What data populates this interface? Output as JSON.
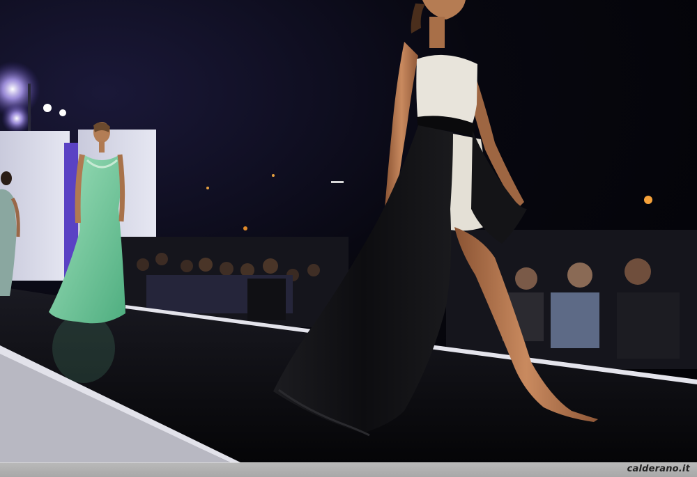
{
  "photo": {
    "subject": "fashion-runway-night-show",
    "colors": {
      "sky": "#05050a",
      "runway": "#0c0c0f",
      "runway_edge": "#d9d9e0",
      "backdrop": "#dcdde8",
      "backdrop_accent": "#6a4fd0",
      "green_gown": "#6fc79a",
      "black_skirt": "#111113",
      "lace_top": "#e9e6df",
      "skin": "#b87a52",
      "stage_light": "#c8b8ff"
    }
  },
  "watermark": {
    "text": "calderano.it"
  }
}
